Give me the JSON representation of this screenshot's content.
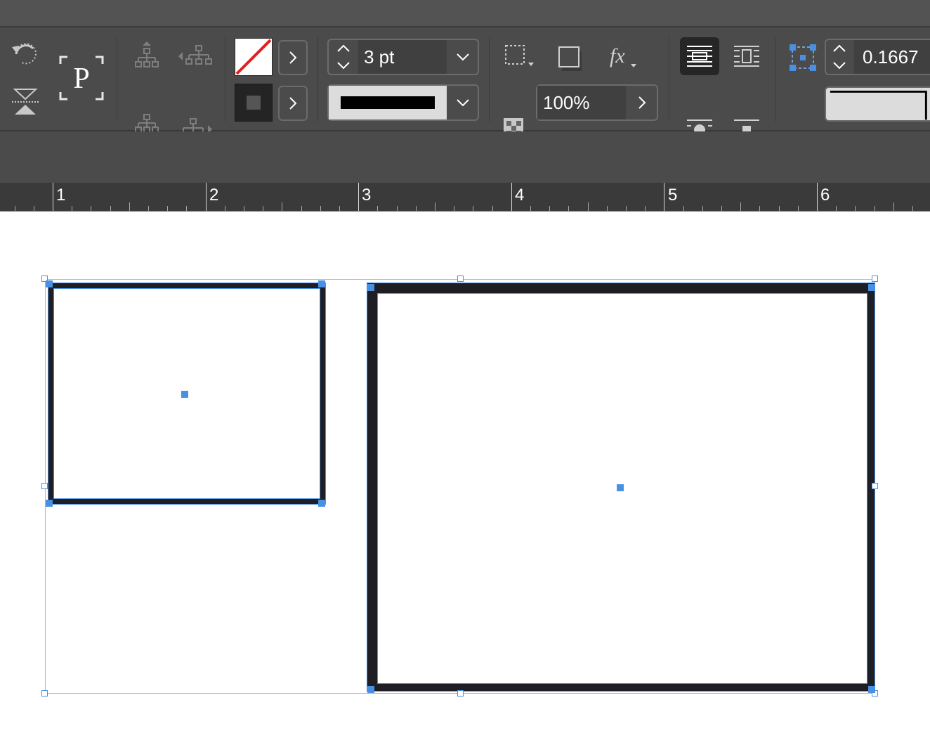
{
  "control_panel": {
    "stroke_weight": {
      "value": "3 pt"
    },
    "opacity": {
      "value": "100%"
    },
    "reference_value": {
      "value": "0.1667"
    },
    "fill_swatch": "none",
    "stroke_color": "#000000"
  },
  "ruler": {
    "labels": [
      "1",
      "2",
      "3",
      "4",
      "5",
      "6"
    ]
  },
  "colors": {
    "selection": "#4a90e2",
    "frame_stroke": "#1e1e24",
    "ui_background": "#4b4b4b"
  }
}
